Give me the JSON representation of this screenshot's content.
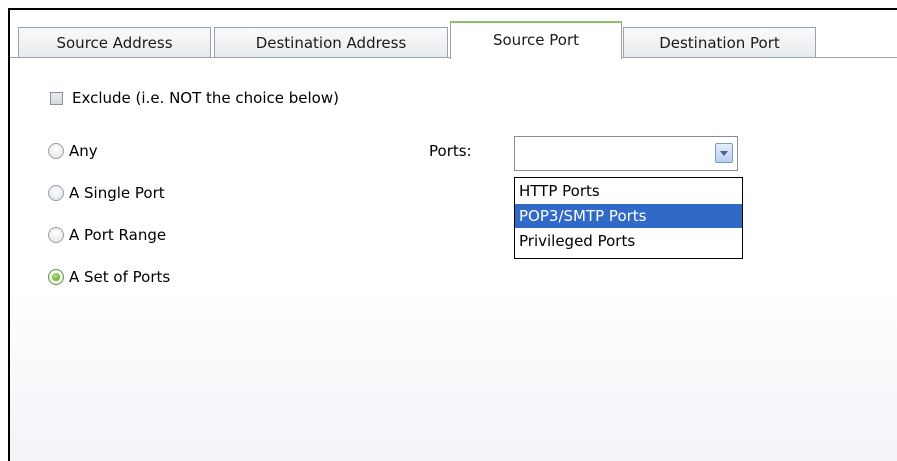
{
  "tabs": [
    {
      "label": "Source Address",
      "active": false
    },
    {
      "label": "Destination Address",
      "active": false
    },
    {
      "label": "Source Port",
      "active": true
    },
    {
      "label": "Destination Port",
      "active": false
    }
  ],
  "exclude": {
    "label": "Exclude (i.e. NOT the choice below)",
    "checked": false
  },
  "radios": [
    {
      "label": "Any",
      "checked": false
    },
    {
      "label": "A Single Port",
      "checked": false
    },
    {
      "label": "A Port Range",
      "checked": false
    },
    {
      "label": "A Set of Ports",
      "checked": true
    }
  ],
  "ports": {
    "label": "Ports:",
    "value": "",
    "options": [
      {
        "label": "HTTP Ports",
        "selected": false
      },
      {
        "label": "POP3/SMTP Ports",
        "selected": true
      },
      {
        "label": "Privileged Ports",
        "selected": false
      }
    ]
  },
  "colors": {
    "active_tab_accent": "#8cc06a",
    "selection": "#3169c6",
    "radio_checked": "#4f9a1c"
  }
}
